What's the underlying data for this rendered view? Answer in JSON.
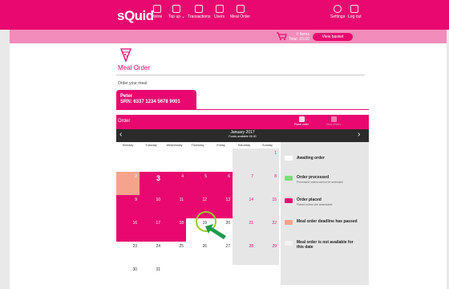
{
  "nav": {
    "logo": "sQuid",
    "items": [
      {
        "label": "Home",
        "icon": "home-icon"
      },
      {
        "label": "Top up ⌄",
        "icon": "top-up-icon"
      },
      {
        "label": "Transactions",
        "icon": "transactions-icon"
      },
      {
        "label": "Users",
        "icon": "users-icon"
      },
      {
        "label": "Meal Order",
        "icon": "meal-order-icon"
      }
    ],
    "settings": "Settings",
    "logout": "Log out"
  },
  "basket": {
    "items": "0 Items",
    "total": "Total: £0.00",
    "button": "View basket"
  },
  "page": {
    "title": "Meal Order",
    "subtitle": "Order your meal"
  },
  "child": {
    "name": "Peter",
    "srn": "SRN: 6337 1234 5678 9001"
  },
  "order": {
    "title": "Order",
    "tabs": [
      {
        "label": "Place order",
        "icon": "calendar-icon"
      },
      {
        "label": "View orders",
        "icon": "list-icon"
      }
    ],
    "month": "January 2017",
    "month_sub": "Funds available £6.00"
  },
  "calendar": {
    "days": [
      "Monday",
      "Tuesday",
      "Wednesday",
      "Thursday",
      "Friday",
      "Saturday",
      "Sunday"
    ],
    "weeks": [
      [
        null,
        null,
        null,
        null,
        null,
        null,
        "1"
      ],
      [
        "2",
        "3",
        "4",
        "5",
        "6",
        "7",
        "8"
      ],
      [
        "9",
        "10",
        "11",
        "12",
        "13",
        "14",
        "15"
      ],
      [
        "16",
        "17",
        "18",
        "19",
        "20",
        "21",
        "22"
      ],
      [
        "23",
        "24",
        "25",
        "26",
        "27",
        "28",
        "29"
      ],
      [
        "30",
        "31",
        null,
        null,
        null,
        null,
        null
      ]
    ],
    "status": [
      [
        null,
        null,
        null,
        null,
        null,
        "grey",
        "grey"
      ],
      [
        "salmon",
        "pink",
        "pink",
        "pink",
        "pink",
        "grey",
        "grey"
      ],
      [
        "pink",
        "pink",
        "pink",
        "pink",
        "pink",
        "grey",
        "grey"
      ],
      [
        "pink",
        "pink",
        "pink",
        "white",
        "white",
        "grey",
        "grey"
      ],
      [
        "white",
        "white",
        "white",
        "white",
        "white",
        "grey",
        "grey"
      ],
      [
        "white",
        "white",
        null,
        null,
        null,
        null,
        null
      ]
    ]
  },
  "legend": [
    {
      "title": "Awaiting order",
      "sub": "",
      "color": "#ffffff"
    },
    {
      "title": "Order processed",
      "sub": "Processed orders cannot be amended",
      "color": "#7ddc7a"
    },
    {
      "title": "Order placed",
      "sub": "Placed orders are amendable",
      "color": "#e8086f"
    },
    {
      "title": "Meal order deadline has passed",
      "sub": "",
      "color": "#f5a38d"
    },
    {
      "title": "Meal order is not available for this date",
      "sub": "",
      "color": "#f2f2f2"
    }
  ],
  "colors": {
    "brand": "#e8086f",
    "highlight": "#9bcc2d",
    "arrow": "#1a9a4a"
  }
}
